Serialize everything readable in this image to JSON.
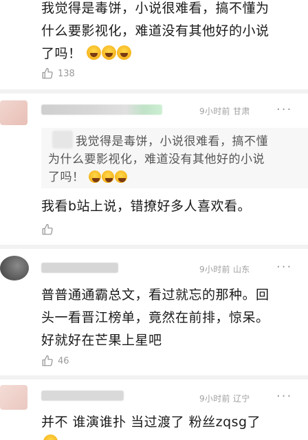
{
  "comment_top": {
    "lines": [
      "我觉得是毒饼，小说很难看，搞不懂为",
      "什么要影视化，难道没有其他好的小说",
      "了吗！"
    ],
    "emojis": [
      "laugh-cry-emoji",
      "laugh-cry-emoji",
      "laugh-cry-emoji"
    ],
    "likes": "138"
  },
  "reply_1": {
    "meta": "9小时前 甘肃",
    "quote_lines": [
      "我觉得是毒饼，小说很难看，搞不懂",
      "为什么要影视化，难道没有其他好的小说",
      "了吗！"
    ],
    "text": "我看b站上说，错撩好多人喜欢看。"
  },
  "comment_2": {
    "meta": "9小时前 山东",
    "lines": [
      "普普通通霸总文，看过就忘的那种。回",
      "头一看晋江榜单，竟然在前排，惊呆。",
      "好就好在芒果上星吧"
    ],
    "likes": "46"
  },
  "comment_3": {
    "meta": "9小时前 辽宁",
    "text": "并不 谁演谁扑 当过渡了 粉丝zqsg了"
  },
  "more_label": "···",
  "colors": {
    "meta_gray": "#a0a0a0",
    "like_gray": "#9a9a9a",
    "quote_bg": "#f7f7f7"
  }
}
